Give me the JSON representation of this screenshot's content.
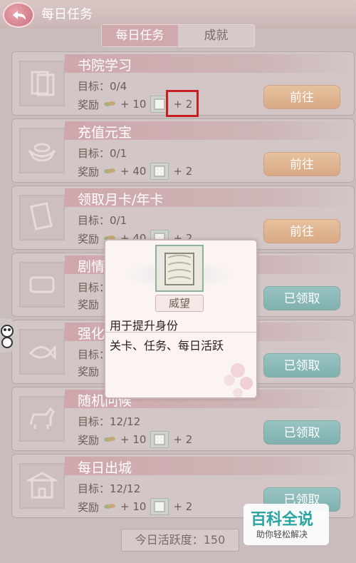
{
  "header": {
    "title": "每日任务"
  },
  "tabs": [
    {
      "label": "每日任务",
      "active": true
    },
    {
      "label": "成就",
      "active": false
    }
  ],
  "reward_labels": {
    "target": "目标：",
    "reward": "奖励"
  },
  "tasks": [
    {
      "title": "书院学习",
      "target": "0/4",
      "copper": "+ 10",
      "prestige": "+ 2",
      "button": "前往",
      "button_state": "go",
      "icon": "book-icon"
    },
    {
      "title": "充值元宝",
      "target": "0/1",
      "copper": "+ 40",
      "prestige": "+ 2",
      "button": "前往",
      "button_state": "go",
      "icon": "ingot-icon"
    },
    {
      "title": "领取月卡/年卡",
      "target": "0/1",
      "copper": "+ 40",
      "prestige": "+ 2",
      "button": "前往",
      "button_state": "go",
      "icon": "card-icon"
    },
    {
      "title": "剧情",
      "target": "",
      "copper": "",
      "prestige": "",
      "button": "已领取",
      "button_state": "done",
      "icon": "scroll-icon"
    },
    {
      "title": "强化",
      "target": "",
      "copper": "",
      "prestige": "",
      "button": "已领取",
      "button_state": "done",
      "icon": "fish-icon"
    },
    {
      "title": "随机问候",
      "target": "12/12",
      "copper": "+ 10",
      "prestige": "+ 2",
      "button": "已领取",
      "button_state": "done",
      "icon": "horse-icon"
    },
    {
      "title": "每日出城",
      "target": "12/12",
      "copper": "+ 10",
      "prestige": "+ 2",
      "button": "已领取",
      "button_state": "done",
      "icon": "gate-icon"
    }
  ],
  "activity": {
    "label": "今日活跃度：",
    "value": "150"
  },
  "popup": {
    "item_name": "威望",
    "description": "用于提升身份",
    "sources": "关卡、任务、每日活跃"
  },
  "watermark": {
    "title": "百科全说",
    "subtitle": "助你轻松解决"
  },
  "colors": {
    "go_button": "#e0b592",
    "done_button": "#8dbab8",
    "highlight": "#c51f24",
    "title_text": "#ffffff"
  }
}
